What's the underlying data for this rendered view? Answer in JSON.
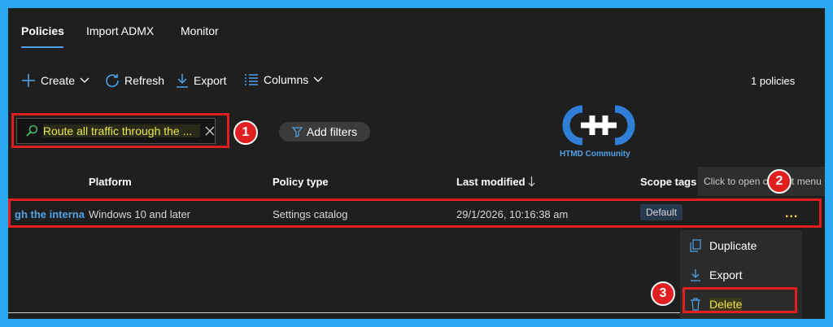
{
  "tabs": [
    {
      "label": "Policies",
      "active": true
    },
    {
      "label": "Import ADMX",
      "active": false
    },
    {
      "label": "Monitor",
      "active": false
    }
  ],
  "toolbar": {
    "create": "Create",
    "refresh": "Refresh",
    "export": "Export",
    "columns": "Columns",
    "count": "1 policies"
  },
  "search": {
    "value": "Route all traffic through the ..."
  },
  "filters": {
    "add_label": "Add filters"
  },
  "logo": {
    "text": "HTMD Community"
  },
  "table": {
    "headers": [
      "Platform",
      "Policy type",
      "Last modified",
      "Scope tags"
    ],
    "row": {
      "name": "gh the interna",
      "platform": "Windows 10 and later",
      "policy_type": "Settings catalog",
      "last_modified": "29/1/2026, 10:16:38 am",
      "scope_tag": "Default",
      "more": "..."
    }
  },
  "tooltip": "Click to open context menu",
  "context_menu": {
    "items": [
      "Duplicate",
      "Export",
      "Delete"
    ]
  },
  "annotations": [
    "1",
    "2",
    "3"
  ],
  "colors": {
    "frame": "#29a8f0",
    "background": "#1f1f1f",
    "accent": "#4fa3e8",
    "highlight": "#f3e346",
    "annotation": "#e02020"
  }
}
